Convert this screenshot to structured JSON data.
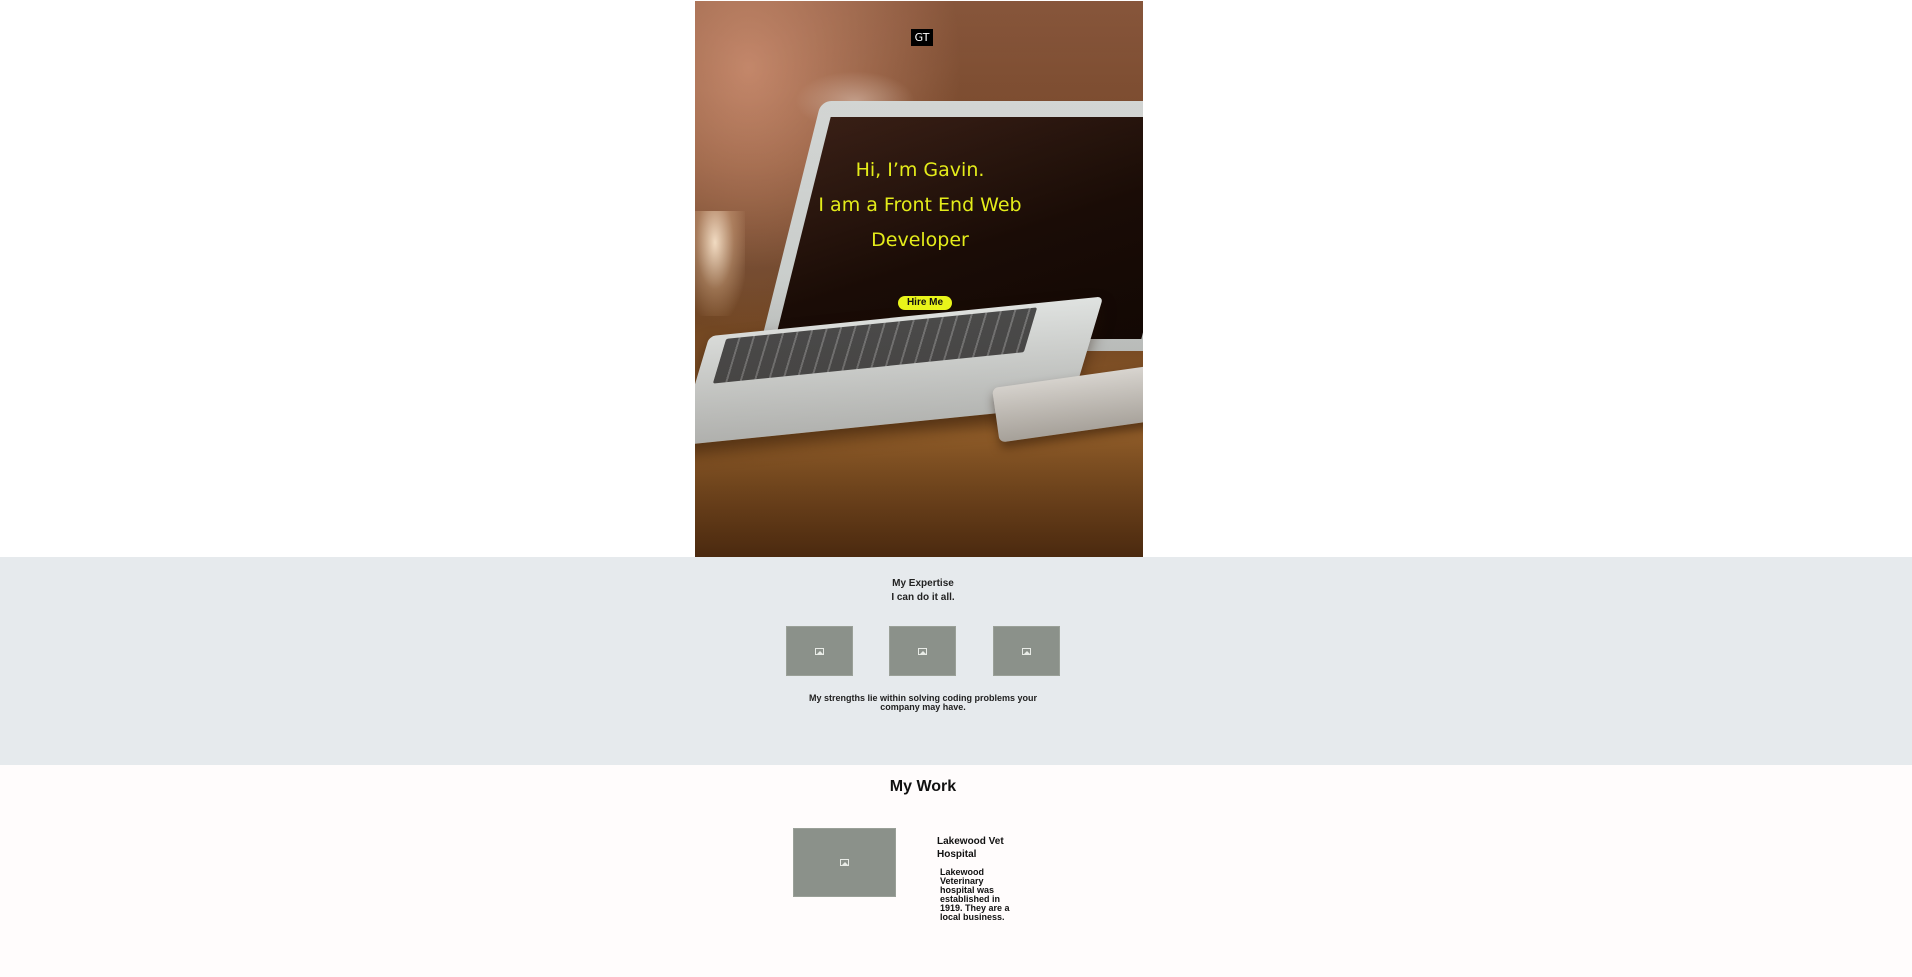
{
  "hero": {
    "logo": "GT",
    "greeting_lines": [
      "Hi, I’m Gavin.",
      "I am a Front End Web",
      "Developer"
    ],
    "hire_button_label": "Hire Me",
    "accent_color": "#e4ec1a"
  },
  "expertise": {
    "heading": "My Expertise",
    "subheading": "I can do it all.",
    "images": [
      "image-icon",
      "image-icon",
      "image-icon"
    ],
    "strengths_text": "My strengths lie within solving coding problems your company may have.",
    "background_color": "#e6eaed"
  },
  "work": {
    "title": "My Work",
    "projects": [
      {
        "image": "image-icon",
        "title": "Lakewood Vet Hospital",
        "description": "Lakewood Veterinary hospital was established in 1919. They are a local business."
      }
    ]
  }
}
